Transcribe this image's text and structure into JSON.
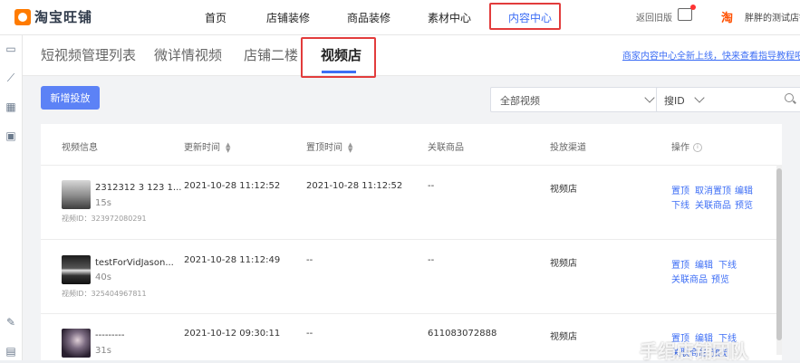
{
  "brand": {
    "name": "淘宝旺铺"
  },
  "nav": {
    "items": [
      {
        "label": "首页"
      },
      {
        "label": "店铺装修"
      },
      {
        "label": "商品装修"
      },
      {
        "label": "素材中心"
      },
      {
        "label": "内容中心"
      }
    ],
    "active_index": 4,
    "old_version": "返回旧版",
    "user": "胖胖的测试店铺"
  },
  "tabs": {
    "items": [
      {
        "label": "短视频管理列表"
      },
      {
        "label": "微详情视频"
      },
      {
        "label": "店铺二楼"
      },
      {
        "label": "视频店"
      }
    ],
    "active_index": 3,
    "notice": "商家内容中心全新上线，快来查看指导教程吧!"
  },
  "toolbar": {
    "add_button": "新增投放",
    "filter_value": "全部视频",
    "search_type": "搜ID",
    "search_placeholder": ""
  },
  "table": {
    "headers": {
      "info": "视频信息",
      "updated": "更新时间",
      "pinned": "置顶时间",
      "goods": "关联商品",
      "channel": "投放渠道",
      "actions": "操作"
    },
    "id_prefix": "视频ID：",
    "rows": [
      {
        "title": "2312312 3 123 1...",
        "duration": "15s",
        "video_id": "323972080291",
        "updated": "2021-10-28 11:12:52",
        "pinned": "2021-10-28 11:12:52",
        "goods": "--",
        "channel": "视频店",
        "actions": [
          "置顶",
          "取消置顶",
          "编辑",
          "下线",
          "关联商品",
          "预览"
        ]
      },
      {
        "title": "testForVidJason...",
        "duration": "40s",
        "video_id": "325404967811",
        "updated": "2021-10-28 11:12:49",
        "pinned": "--",
        "goods": "--",
        "channel": "视频店",
        "actions": [
          "置顶",
          "编辑",
          "下线",
          "关联商品",
          "预览"
        ]
      },
      {
        "title": "---------",
        "duration": "31s",
        "video_id": "",
        "updated": "2021-10-12 09:30:11",
        "pinned": "--",
        "goods": "611083072888",
        "channel": "视频店",
        "actions": [
          "置顶",
          "编辑",
          "下线",
          "关联商品",
          "预览"
        ]
      }
    ]
  },
  "watermark": "手绢店铺团队"
}
